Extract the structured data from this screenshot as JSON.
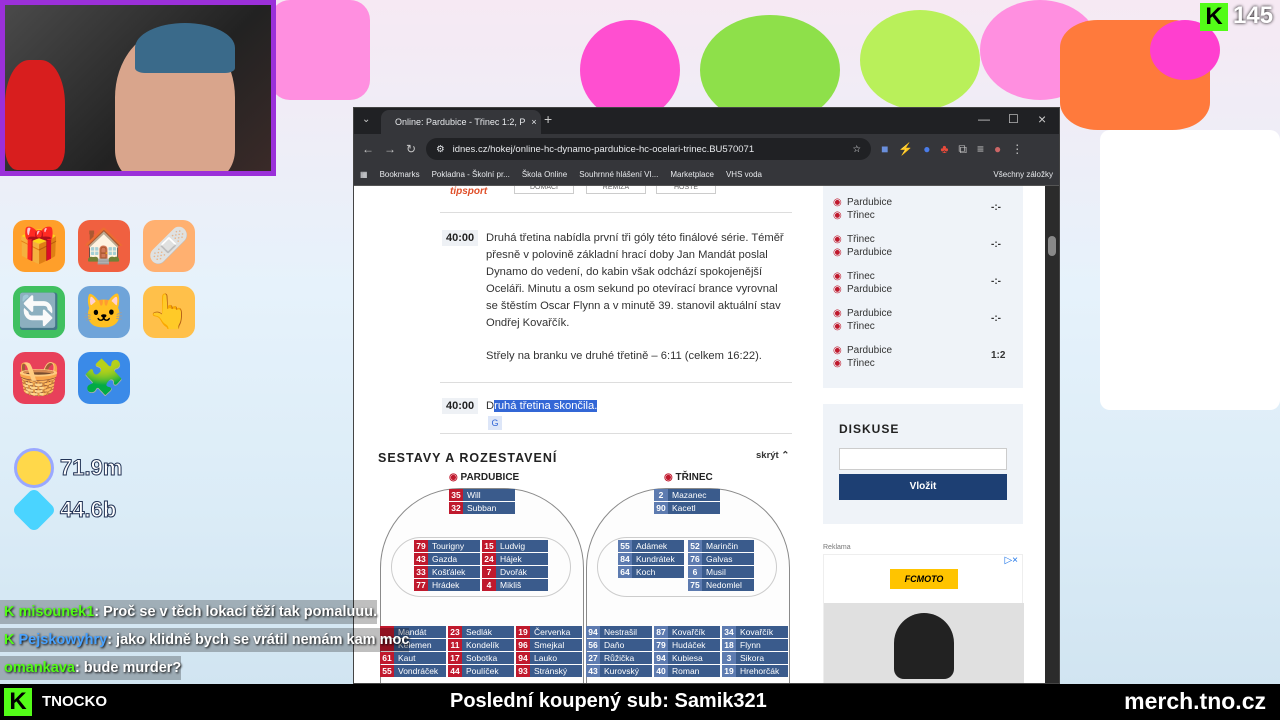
{
  "stream": {
    "viewer_count": "145",
    "brand": "TNOCKO",
    "last_sub": "Poslední koupený sub: Samik321",
    "merch": "merch.tno.cz"
  },
  "game": {
    "coins": "71.9m",
    "diamonds": "44.6b"
  },
  "chat": [
    {
      "user": "misounek1",
      "text": ": Proč se v těch lokací těží tak pomaluuu."
    },
    {
      "user": "Pejskowyhry",
      "text": ": jako klidně bych se vrátil nemám kam moc"
    },
    {
      "user": "omankava",
      "text": ": bude murder?"
    }
  ],
  "browser": {
    "tab_title": "Online: Pardubice - Třinec 1:2, P",
    "url": "idnes.cz/hokej/online-hc-dynamo-pardubice-hc-ocelari-trinec.BU570071",
    "bookmarks": [
      "Bookmarks",
      "Pokladna - Školní pr...",
      "Škola Online",
      "Souhrnné hlášení VI...",
      "Marketplace",
      "VHS voda"
    ],
    "all_bookmarks": "Všechny záložky"
  },
  "article": {
    "bet_buttons": [
      "DOMÁCÍ",
      "REMÍZA",
      "HOSTÉ"
    ],
    "entries": [
      {
        "time": "40:00",
        "p1": "Druhá třetina nabídla první tři góly této finálové série. Téměř přesně v polovině základní hrací doby Jan Mandát poslal Dynamo do vedení, do kabin však odchází spokojenější Oceláři. Minutu a osm sekund po otevírací brance vyrovnal se štěstím Oscar Flynn a v minutě 39. stanovil aktuální stav Ondřej Kovařčík.",
        "p2": "Střely na branku ve druhé třetině – 6:11 (celkem 16:22)."
      },
      {
        "time": "40:00",
        "first": "D",
        "sel": "ruhá třetina skončila."
      }
    ],
    "lineups_title": "SESTAVY A ROZESTAVENÍ",
    "hide": "skrýt",
    "home": "PARDUBICE",
    "away": "TŘINEC",
    "home_players": [
      {
        "num": "35",
        "name": "Will"
      },
      {
        "num": "32",
        "name": "Subban"
      },
      {
        "num": "79",
        "name": "Tourigny"
      },
      {
        "num": "15",
        "name": "Ludvig"
      },
      {
        "num": "43",
        "name": "Gazda"
      },
      {
        "num": "24",
        "name": "Hájek"
      },
      {
        "num": "33",
        "name": "Košťálek"
      },
      {
        "num": "7",
        "name": "Dvořák"
      },
      {
        "num": "77",
        "name": "Hrádek"
      },
      {
        "num": "4",
        "name": "Mikliš"
      },
      {
        "num": "",
        "name": "Mandát"
      },
      {
        "num": "23",
        "name": "Sedlák"
      },
      {
        "num": "19",
        "name": "Červenka"
      },
      {
        "num": "",
        "name": "Kelemen"
      },
      {
        "num": "11",
        "name": "Kondelík"
      },
      {
        "num": "96",
        "name": "Smejkal"
      },
      {
        "num": "61",
        "name": "Kaut"
      },
      {
        "num": "17",
        "name": "Sobotka"
      },
      {
        "num": "94",
        "name": "Lauko"
      },
      {
        "num": "55",
        "name": "Vondráček"
      },
      {
        "num": "44",
        "name": "Poulíček"
      },
      {
        "num": "93",
        "name": "Stránský"
      }
    ],
    "away_players": [
      {
        "num": "2",
        "name": "Mazanec"
      },
      {
        "num": "90",
        "name": "Kacetl"
      },
      {
        "num": "55",
        "name": "Adámek"
      },
      {
        "num": "52",
        "name": "Marinčin"
      },
      {
        "num": "84",
        "name": "Kundrátek"
      },
      {
        "num": "76",
        "name": "Galvas"
      },
      {
        "num": "64",
        "name": "Koch"
      },
      {
        "num": "6",
        "name": "Musil"
      },
      {
        "num": "75",
        "name": "Nedomlel"
      },
      {
        "num": "94",
        "name": "Nestrašil"
      },
      {
        "num": "87",
        "name": "Kovařčík"
      },
      {
        "num": "34",
        "name": "Kovařčík"
      },
      {
        "num": "56",
        "name": "Daňo"
      },
      {
        "num": "79",
        "name": "Hudáček"
      },
      {
        "num": "18",
        "name": "Flynn"
      },
      {
        "num": "27",
        "name": "Růžička"
      },
      {
        "num": "94",
        "name": "Kubiesa"
      },
      {
        "num": "3",
        "name": "Sikora"
      },
      {
        "num": "43",
        "name": "Kurovský"
      },
      {
        "num": "40",
        "name": "Roman"
      },
      {
        "num": "19",
        "name": "Hrehorčák"
      }
    ]
  },
  "sidebar": {
    "matches": [
      {
        "a": "Pardubice",
        "b": "Třinec",
        "score": "-:-"
      },
      {
        "a": "Třinec",
        "b": "Pardubice",
        "score": "-:-"
      },
      {
        "a": "Třinec",
        "b": "Pardubice",
        "score": "-:-"
      },
      {
        "a": "Pardubice",
        "b": "Třinec",
        "score": "-:-"
      },
      {
        "a": "Pardubice",
        "b": "Třinec",
        "score": "1:2"
      }
    ],
    "discussion_title": "DISKUSE",
    "login_button": "Vložit",
    "ad_label": "Reklama",
    "ad_brand": "FCMOTO"
  },
  "colors": {
    "kick": "#53fc18",
    "cam_border": "#9b30d9",
    "idnes_blue": "#1d3f73"
  }
}
